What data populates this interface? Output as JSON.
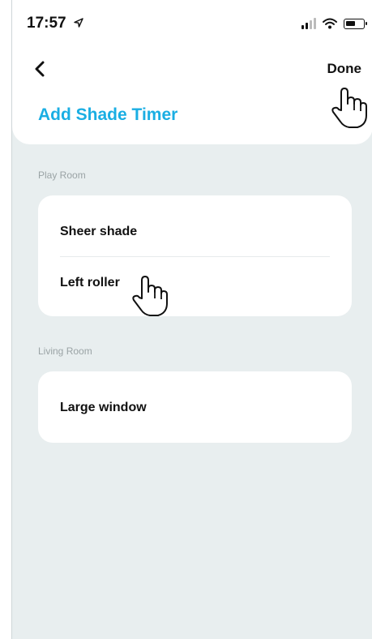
{
  "status_bar": {
    "time": "17:57"
  },
  "nav": {
    "done_label": "Done"
  },
  "page": {
    "title": "Add Shade Timer"
  },
  "sections": [
    {
      "label": "Play Room",
      "items": [
        "Sheer shade",
        "Left roller"
      ]
    },
    {
      "label": "Living Room",
      "items": [
        "Large window"
      ]
    }
  ],
  "icons": {
    "back": "chevron-left-icon",
    "location": "location-arrow-icon",
    "signal": "cellular-signal-icon",
    "wifi": "wifi-icon",
    "battery": "battery-icon",
    "pointer": "hand-pointer-icon"
  },
  "colors": {
    "accent": "#1aaee3",
    "background": "#e8eeef"
  }
}
